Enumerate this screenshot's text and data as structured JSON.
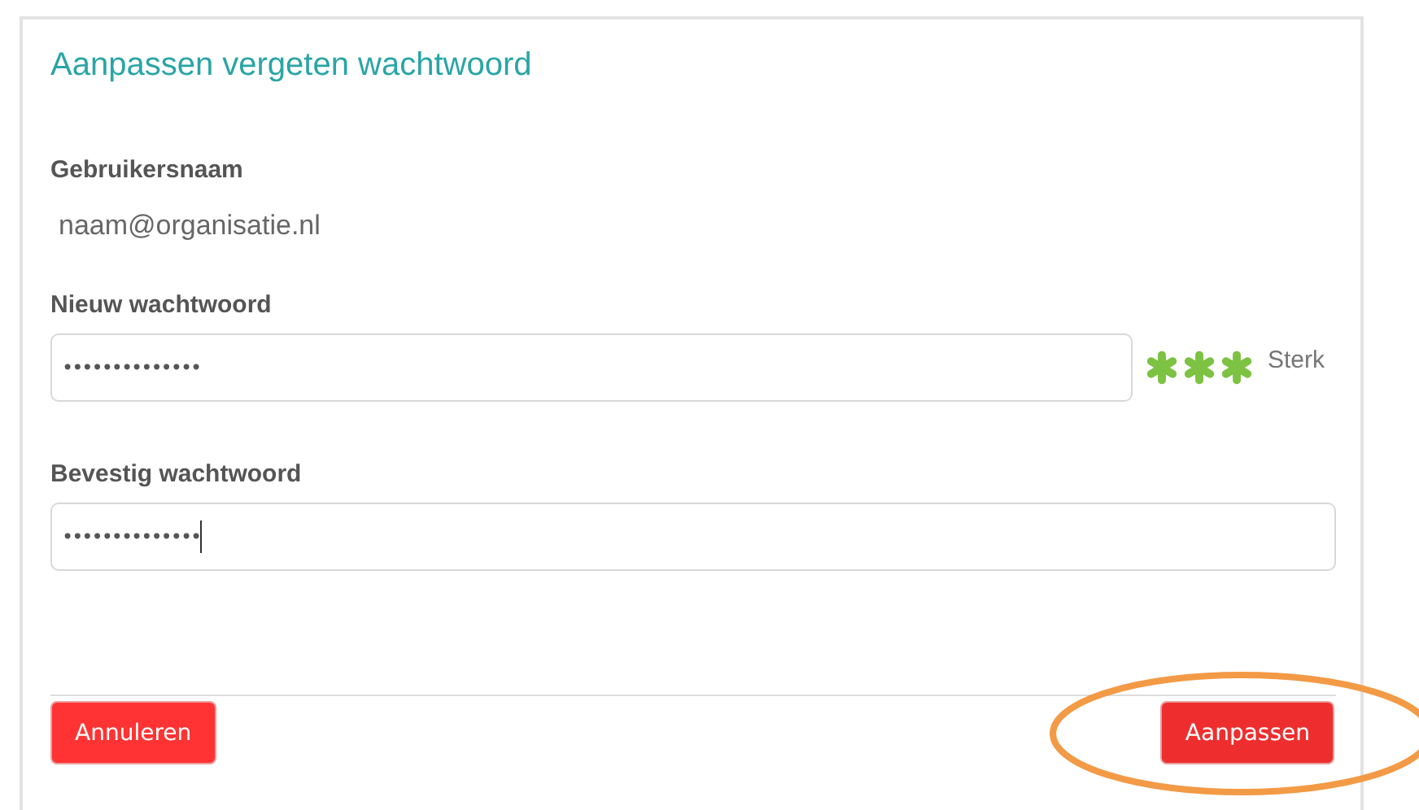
{
  "dialog": {
    "title": "Aanpassen vergeten wachtwoord"
  },
  "username": {
    "label": "Gebruikersnaam",
    "value": "naam@organisatie.nl"
  },
  "new_password": {
    "label": "Nieuw wachtwoord",
    "value": "••••••••••••••",
    "focused": false,
    "strength": {
      "stars": 3,
      "label": "Sterk"
    }
  },
  "confirm_password": {
    "label": "Bevestig wachtwoord",
    "value": "••••••••••••••",
    "focused": true
  },
  "buttons": [
    {
      "label": "Annuleren",
      "kind": "cancel"
    },
    {
      "label": "Aanpassen",
      "kind": "submit"
    }
  ],
  "annotation": {
    "kind": "ellipse"
  }
}
